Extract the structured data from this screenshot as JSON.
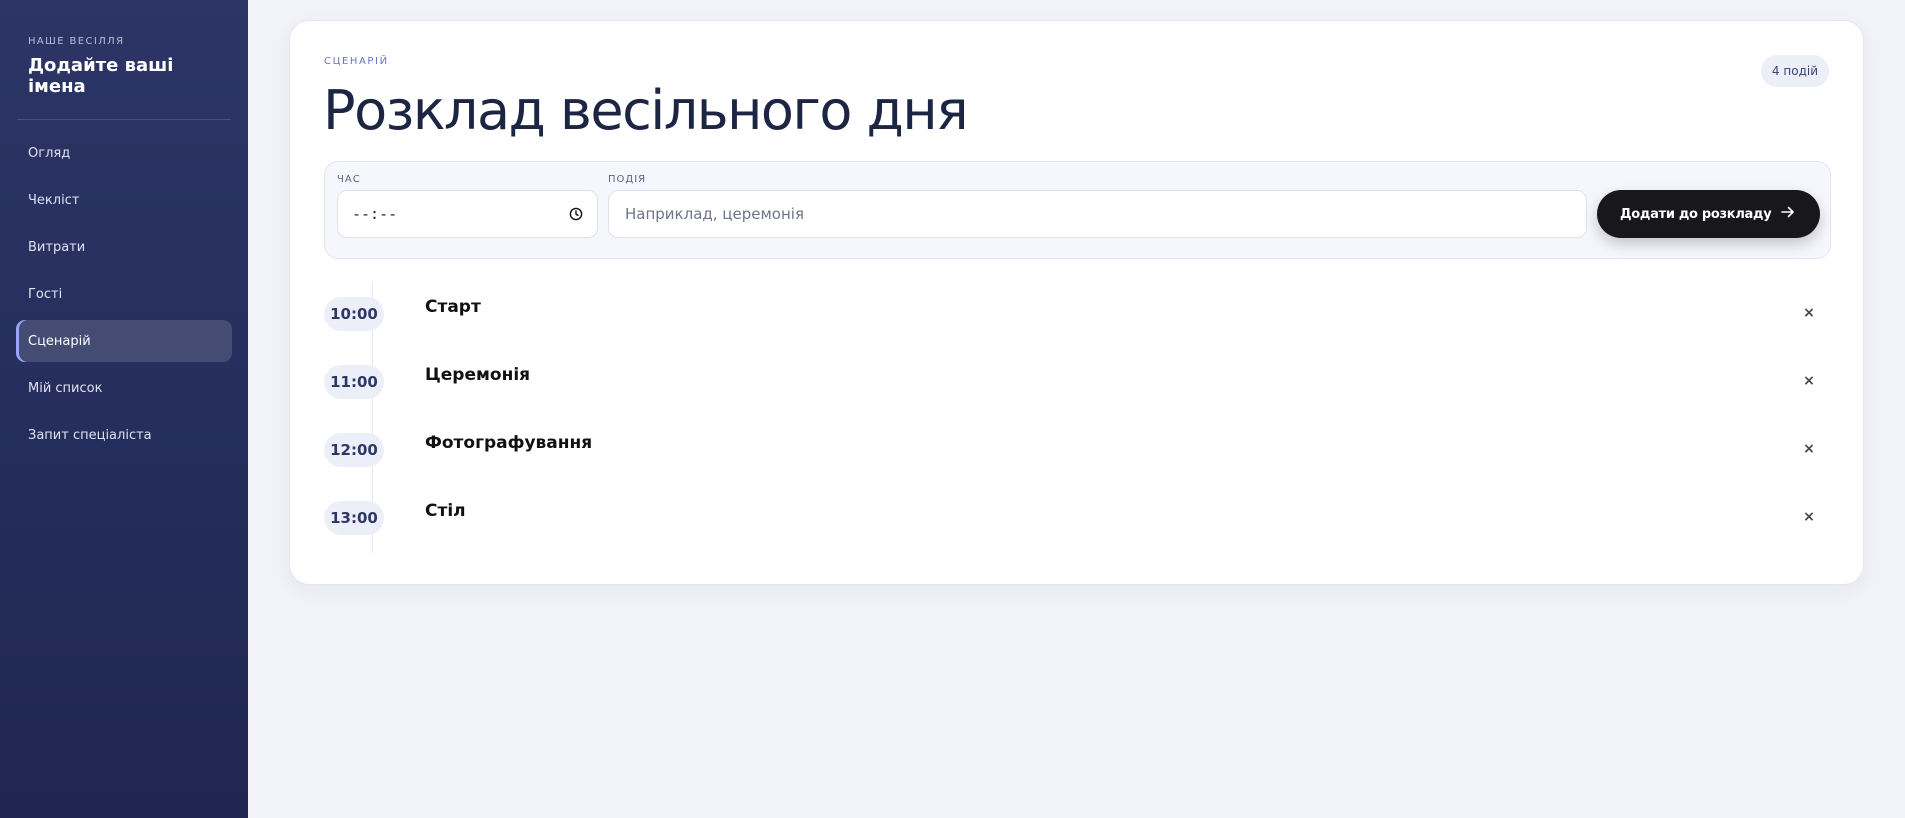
{
  "sidebar": {
    "eyebrow": "НАШЕ ВЕСІЛЛЯ",
    "title": "Додайте ваші імена",
    "items": [
      {
        "label": "Огляд"
      },
      {
        "label": "Чекліст"
      },
      {
        "label": "Витрати"
      },
      {
        "label": "Гості"
      },
      {
        "label": "Сценарій",
        "active": true
      },
      {
        "label": "Мій список"
      },
      {
        "label": "Запит спеціаліста"
      }
    ]
  },
  "header": {
    "eyebrow": "СЦЕНАРІЙ",
    "title": "Розклад весільного дня",
    "count_number": "4",
    "count_label": "подій"
  },
  "form": {
    "time_label": "ЧАС",
    "time_value": "--:--",
    "event_label": "ПОДІЯ",
    "event_placeholder": "Наприклад, церемонія",
    "submit_label": "Додати до розкладу",
    "submit_icon": "arrow-right-icon"
  },
  "timeline": [
    {
      "time": "10:00",
      "title": "Старт",
      "remove": "×"
    },
    {
      "time": "11:00",
      "title": "Церемонія",
      "remove": "×"
    },
    {
      "time": "12:00",
      "title": "Фотографування",
      "remove": "×"
    },
    {
      "time": "13:00",
      "title": "Стіл",
      "remove": "×"
    }
  ],
  "colors": {
    "sidebar_bg": "#252e5c",
    "accent": "#6b74c7",
    "button_bg": "#17171c",
    "page_bg": "#f2f3f9"
  }
}
